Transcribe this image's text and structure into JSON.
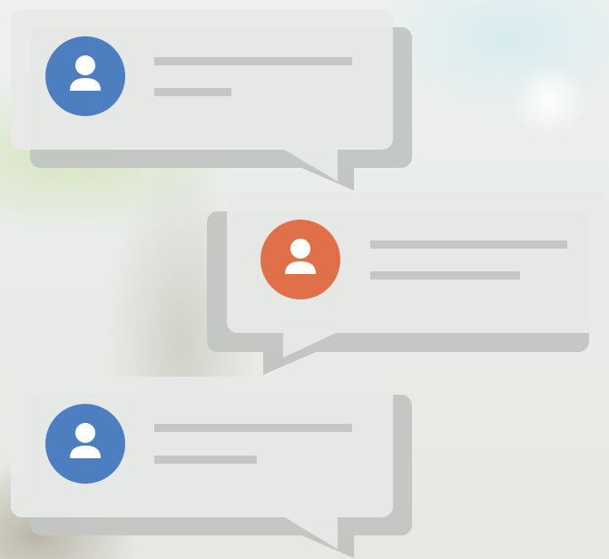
{
  "colors": {
    "avatar_blue": "#4d7fc0",
    "avatar_orange": "#e0704a",
    "placeholder_line": "#c4c7c4"
  },
  "messages": [
    {
      "avatar_icon": "user-icon",
      "avatar_color": "avatar_blue",
      "side": "left"
    },
    {
      "avatar_icon": "user-icon",
      "avatar_color": "avatar_orange",
      "side": "right"
    },
    {
      "avatar_icon": "user-icon",
      "avatar_color": "avatar_blue",
      "side": "left"
    }
  ]
}
